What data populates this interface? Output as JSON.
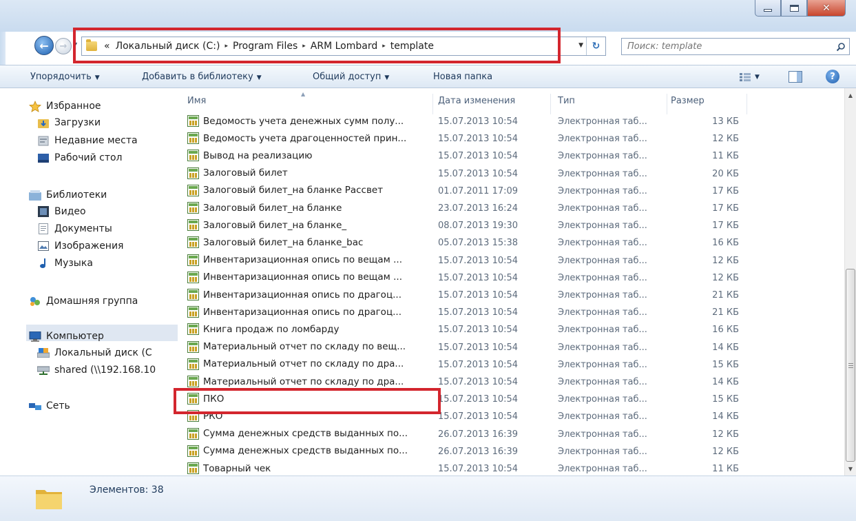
{
  "window": {
    "minimize_icon": "minimize-icon",
    "maximize_icon": "maximize-icon",
    "close_icon": "close-icon"
  },
  "address": {
    "overflow": "«",
    "crumbs": [
      "Локальный диск (C:)",
      "Program Files",
      "ARM Lombard",
      "template"
    ],
    "separator": "▸"
  },
  "search": {
    "placeholder": "Поиск: template"
  },
  "toolbar": {
    "organize": "Упорядочить",
    "add_to_library": "Добавить в библиотеку",
    "share": "Общий доступ",
    "new_folder": "Новая папка"
  },
  "nav": {
    "favorites": "Избранное",
    "downloads": "Загрузки",
    "recent": "Недавние места",
    "desktop": "Рабочий стол",
    "libraries": "Библиотеки",
    "video": "Видео",
    "documents": "Документы",
    "images": "Изображения",
    "music": "Музыка",
    "homegroup": "Домашняя группа",
    "computer": "Компьютер",
    "local_disk": "Локальный диск (С",
    "shared": "shared (\\\\192.168.10",
    "network": "Сеть"
  },
  "columns": {
    "name": "Имя",
    "date": "Дата изменения",
    "type": "Тип",
    "size": "Размер"
  },
  "files": [
    {
      "name": "Ведомость учета денежных сумм полу...",
      "date": "15.07.2013 10:54",
      "type": "Электронная таб...",
      "size": "13 КБ"
    },
    {
      "name": "Ведомость учета драгоценностей прин...",
      "date": "15.07.2013 10:54",
      "type": "Электронная таб...",
      "size": "12 КБ"
    },
    {
      "name": "Вывод на реализацию",
      "date": "15.07.2013 10:54",
      "type": "Электронная таб...",
      "size": "11 КБ"
    },
    {
      "name": "Залоговый билет",
      "date": "15.07.2013 10:54",
      "type": "Электронная таб...",
      "size": "20 КБ"
    },
    {
      "name": "Залоговый билет_на бланке Рассвет",
      "date": "01.07.2011 17:09",
      "type": "Электронная таб...",
      "size": "17 КБ"
    },
    {
      "name": "Залоговый билет_на бланке",
      "date": "23.07.2013 16:24",
      "type": "Электронная таб...",
      "size": "17 КБ"
    },
    {
      "name": "Залоговый билет_на бланке_",
      "date": "08.07.2013 19:30",
      "type": "Электронная таб...",
      "size": "17 КБ"
    },
    {
      "name": "Залоговый билет_на бланке_bac",
      "date": "05.07.2013 15:38",
      "type": "Электронная таб...",
      "size": "16 КБ"
    },
    {
      "name": "Инвентаризационная опись по вещам ...",
      "date": "15.07.2013 10:54",
      "type": "Электронная таб...",
      "size": "12 КБ"
    },
    {
      "name": "Инвентаризационная опись по вещам ...",
      "date": "15.07.2013 10:54",
      "type": "Электронная таб...",
      "size": "12 КБ"
    },
    {
      "name": "Инвентаризационная опись по драгоц...",
      "date": "15.07.2013 10:54",
      "type": "Электронная таб...",
      "size": "21 КБ"
    },
    {
      "name": "Инвентаризационная опись по драгоц...",
      "date": "15.07.2013 10:54",
      "type": "Электронная таб...",
      "size": "21 КБ"
    },
    {
      "name": "Книга продаж по ломбарду",
      "date": "15.07.2013 10:54",
      "type": "Электронная таб...",
      "size": "16 КБ"
    },
    {
      "name": "Материальный отчет по складу по вещ...",
      "date": "15.07.2013 10:54",
      "type": "Электронная таб...",
      "size": "14 КБ"
    },
    {
      "name": "Материальный отчет по складу по дра...",
      "date": "15.07.2013 10:54",
      "type": "Электронная таб...",
      "size": "15 КБ"
    },
    {
      "name": "Материальный отчет по складу по дра...",
      "date": "15.07.2013 10:54",
      "type": "Электронная таб...",
      "size": "14 КБ"
    },
    {
      "name": "ПКО",
      "date": "15.07.2013 10:54",
      "type": "Электронная таб...",
      "size": "15 КБ"
    },
    {
      "name": "РКО",
      "date": "15.07.2013 10:54",
      "type": "Электронная таб...",
      "size": "14 КБ"
    },
    {
      "name": "Сумма денежных средств выданных по...",
      "date": "26.07.2013 16:39",
      "type": "Электронная таб...",
      "size": "12 КБ"
    },
    {
      "name": "Сумма денежных средств выданных по...",
      "date": "26.07.2013 16:39",
      "type": "Электронная таб...",
      "size": "12 КБ"
    },
    {
      "name": "Товарный чек",
      "date": "15.07.2013 10:54",
      "type": "Электронная таб...",
      "size": "11 КБ"
    }
  ],
  "status": {
    "items_count": "Элементов: 38"
  },
  "colors": {
    "highlight": "#d3262e",
    "toolbar_text": "#1e395b"
  }
}
